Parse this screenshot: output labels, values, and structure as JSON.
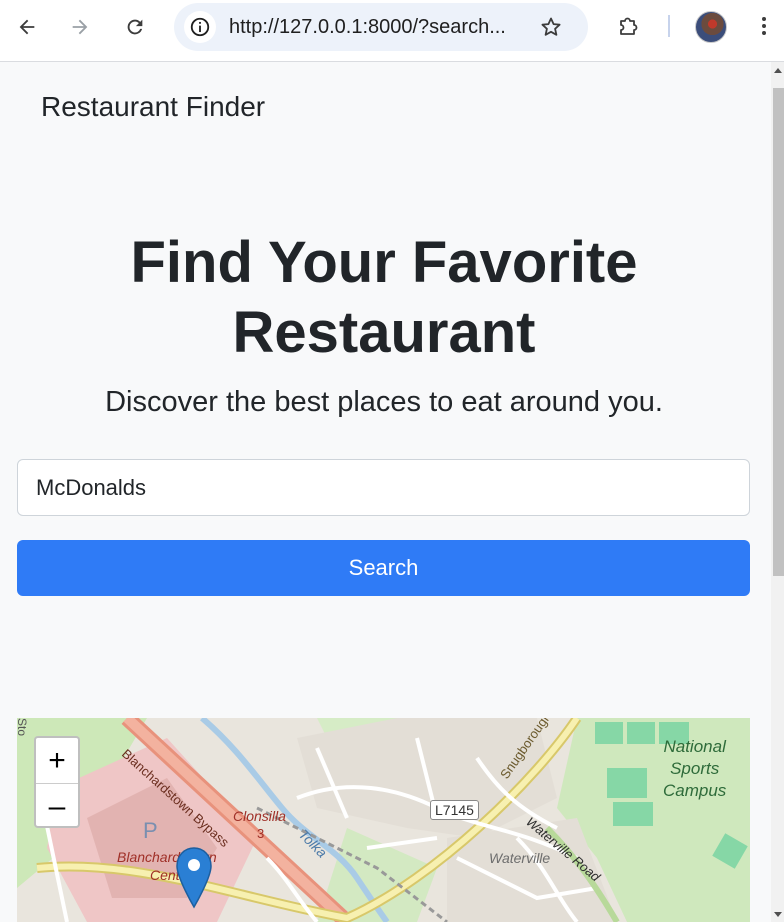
{
  "browser": {
    "url": "http://127.0.0.1:8000/?search...",
    "icons": [
      "back-arrow-icon",
      "forward-arrow-icon",
      "reload-icon",
      "site-info-icon",
      "bookmark-star-icon",
      "extensions-puzzle-icon",
      "profile-avatar",
      "kebab-menu-icon"
    ]
  },
  "navbar": {
    "brand": "Restaurant Finder"
  },
  "hero": {
    "title": "Find Your Favorite Restaurant",
    "subtitle": "Discover the best places to eat around you."
  },
  "search": {
    "value": "McDonalds",
    "button_label": "Search"
  },
  "map": {
    "zoom_in": "+",
    "zoom_out": "–",
    "labels": {
      "bypass": "Blanchardstown Bypass",
      "clonsilla": "Clonsilla",
      "clonsilla_num": "3",
      "tolka": "Tolka",
      "snugborough": "Snugborough",
      "road_shield": "L7145",
      "waterville_road": "Waterville Road",
      "waterville": "Waterville",
      "national_sports": "National",
      "national_sports2": "Sports",
      "national_sports3": "Campus",
      "centre1": "Blanchardstown",
      "centre2": "Centre",
      "parking": "P",
      "edge": "Sto"
    }
  },
  "colors": {
    "primary_button": "#2f7bf6",
    "page_bg": "#f8f9fa",
    "marker": "#2a7fd4"
  }
}
